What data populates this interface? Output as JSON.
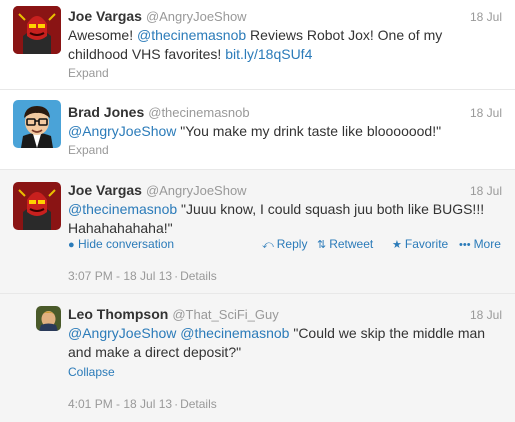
{
  "tweets": [
    {
      "name": "Joe Vargas",
      "handle": "@AngryJoeShow",
      "date": "18 Jul",
      "text_1": "Awesome! ",
      "mention": "@thecinemasnob",
      "text_2": " Reviews Robot Jox! One of my childhood VHS favorites! ",
      "url": "bit.ly/18qSUf4",
      "expand": "Expand"
    },
    {
      "name": "Brad Jones",
      "handle": "@thecinemasnob",
      "date": "18 Jul",
      "mention": "@AngryJoeShow",
      "text": " \"You make my drink taste like blooooood!\"",
      "expand": "Expand"
    },
    {
      "name": "Joe Vargas",
      "handle": "@AngryJoeShow",
      "date": "18 Jul",
      "mention": "@thecinemasnob",
      "text": " \"Juuu know, I could squash juu both like BUGS!!! Hahahahahaha!\"",
      "hide": "Hide conversation",
      "actions": {
        "reply": "Reply",
        "retweet": "Retweet",
        "favorite": "Favorite",
        "more": "More"
      },
      "time": "3:07 PM - 18 Jul 13",
      "details": "Details"
    },
    {
      "name": "Leo Thompson",
      "handle": "@That_SciFi_Guy",
      "date": "18 Jul",
      "mention_1": "@AngryJoeShow",
      "mention_2": "@thecinemasnob",
      "text": " \"Could we skip the middle man and make a direct deposit?\"",
      "collapse": "Collapse",
      "time": "4:01 PM - 18 Jul 13",
      "details": "Details"
    }
  ],
  "icons": {
    "hide": "bullet-icon",
    "reply": "reply-arrow-icon",
    "retweet": "retweet-icon",
    "favorite": "star-icon",
    "more": "dots-icon"
  },
  "colors": {
    "link": "#2b7bb9",
    "muted": "#999999",
    "text": "#333333",
    "expanded_bg": "#f5f5f5"
  }
}
